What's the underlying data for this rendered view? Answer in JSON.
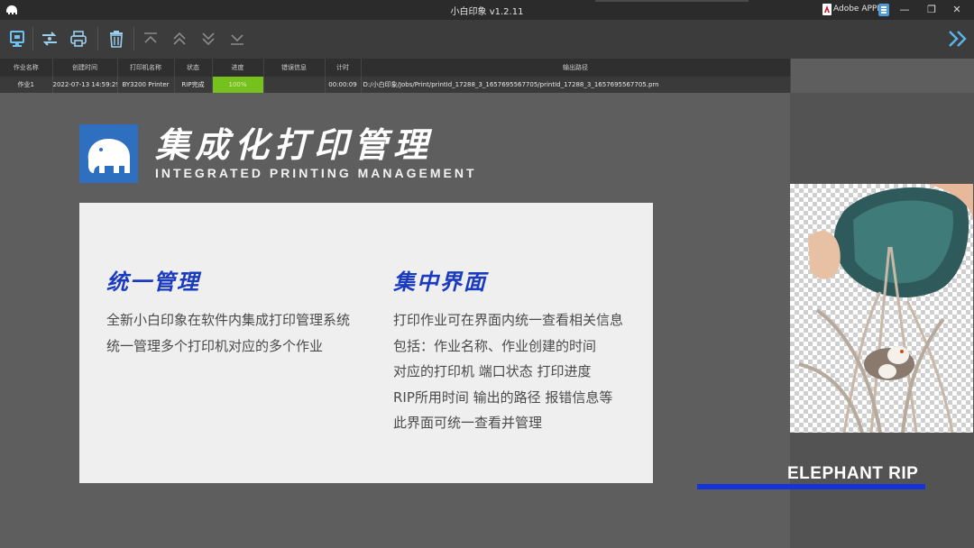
{
  "window": {
    "title": "小白印象 v1.2.11",
    "adobe_label": "Adobe APPE",
    "minimize_glyph": "—",
    "maximize_glyph": "❐",
    "close_glyph": "✕"
  },
  "toolbar": {
    "buttons": [
      "monitor-icon",
      "transfer-icon",
      "printer-icon",
      "trash-icon",
      "move-top-icon",
      "move-up-icon",
      "move-down-icon",
      "move-bottom-icon"
    ],
    "expand_icon": "double-chevron-right-icon"
  },
  "table": {
    "headers": [
      "作业名称",
      "创建时间",
      "打印机名称",
      "状态",
      "进度",
      "错误信息",
      "计时",
      "输出路径"
    ],
    "rows": [
      {
        "name": "作业1",
        "created": "2022-07-13 14:59:29",
        "printer": "BY3200 Printer",
        "status": "RIP完成",
        "progress_label": "100%",
        "progress": 1.0,
        "error": "",
        "time": "00:00:09",
        "path": "D:/小白印象/Jobs/Print/printId_17288_3_1657695567705/printId_17288_3_1657695567705.prn"
      }
    ]
  },
  "hero": {
    "title": "集成化打印管理",
    "subtitle": "INTEGRATED PRINTING MANAGEMENT"
  },
  "card": {
    "left": {
      "heading": "统一管理",
      "lines": [
        "全新小白印象在软件内集成打印管理系统",
        "统一管理多个打印机对应的多个作业"
      ]
    },
    "right": {
      "heading": "集中界面",
      "lines": [
        "打印作业可在界面内统一查看相关信息",
        "包括：作业名称、作业创建的时间",
        "对应的打印机  端口状态  打印进度",
        "RIP所用时间   输出的路径  报错信息等",
        "此界面可统一查看并管理"
      ]
    }
  },
  "brand": {
    "name": "ELEPHANT RIP",
    "accent_color": "#1533d6",
    "logo_color": "#2f6fc0",
    "progress_color": "#77c11f"
  }
}
